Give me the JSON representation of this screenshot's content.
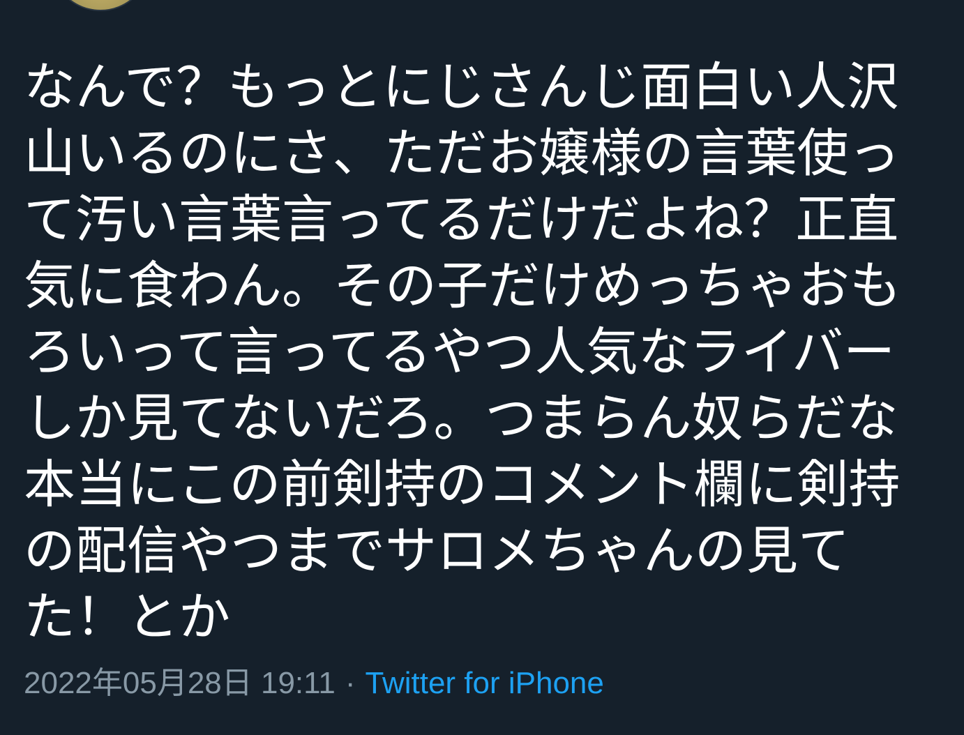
{
  "tweet": {
    "lines": [
      "なんで？もっとにじさんじ面白い人沢",
      "山いるのにさ、ただお嬢様の言葉使っ",
      "て汚い言葉言ってるだけだよね？正直",
      "気に食わん。その子だけめっちゃおも",
      "ろいって言ってるやつ人気なライバー",
      "しか見てないだろ。つまらん奴らだな",
      "本当にこの前剣持のコメント欄に剣持",
      "の配信やつまでサロメちゃんの見て",
      "た！とか"
    ]
  },
  "meta": {
    "timestamp": "2022年05月28日 19:11",
    "separator": "·",
    "source": "Twitter for iPhone"
  },
  "colors": {
    "background": "#15202b",
    "text": "#ffffff",
    "muted": "#8899a6",
    "link": "#1da1f2"
  }
}
